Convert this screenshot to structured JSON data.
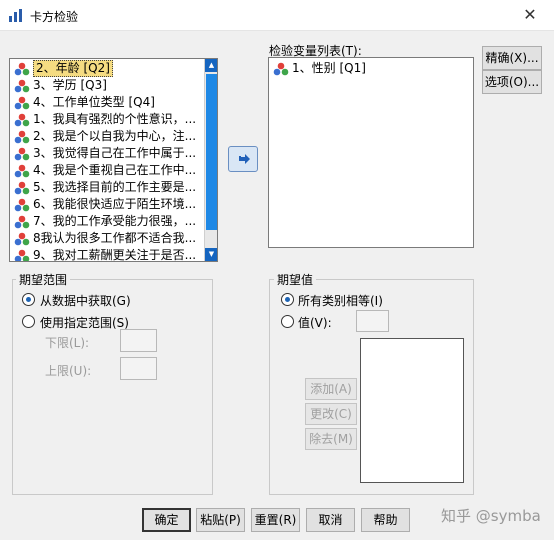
{
  "window": {
    "title": "卡方检验",
    "close_glyph": "✕"
  },
  "source_list": {
    "items": [
      {
        "label": "2、年龄 [Q2]",
        "selected": true
      },
      {
        "label": "3、学历 [Q3]",
        "selected": false
      },
      {
        "label": "4、工作单位类型 [Q4]",
        "selected": false
      },
      {
        "label": "1、我具有强烈的个性意识，...",
        "selected": false
      },
      {
        "label": "2、我是个以自我为中心，注...",
        "selected": false
      },
      {
        "label": "3、我觉得自己在工作中属于...",
        "selected": false
      },
      {
        "label": "4、我是个重视自己在工作中...",
        "selected": false
      },
      {
        "label": "5、我选择目前的工作主要是...",
        "selected": false
      },
      {
        "label": "6、我能很快适应于陌生环境...",
        "selected": false
      },
      {
        "label": "7、我的工作承受能力很强，...",
        "selected": false
      },
      {
        "label": "8我认为很多工作都不适合我...",
        "selected": false
      },
      {
        "label": "9、我对工薪酬更关注于是否...",
        "selected": false
      }
    ],
    "icon": "nominal-variable-icon"
  },
  "move_button": {
    "icon": "arrow-right-icon"
  },
  "test_list": {
    "label": "检验变量列表(T):",
    "items": [
      {
        "label": "1、性别 [Q1]"
      }
    ]
  },
  "side_buttons": {
    "exact": "精确(X)...",
    "options": "选项(O)..."
  },
  "expected_range": {
    "title": "期望范围",
    "from_data": "从数据中获取(G)",
    "use_range": "使用指定范围(S)",
    "lower": "下限(L):",
    "upper": "上限(U):",
    "selected": "from_data"
  },
  "expected_values": {
    "title": "期望值",
    "all_equal": "所有类别相等(I)",
    "values": "值(V):",
    "add": "添加(A)",
    "change": "更改(C)",
    "remove": "除去(M)",
    "selected": "all_equal"
  },
  "footer": {
    "ok": "确定",
    "paste": "粘贴(P)",
    "reset": "重置(R)",
    "cancel": "取消",
    "help": "帮助"
  },
  "watermark": "知乎 @symba"
}
